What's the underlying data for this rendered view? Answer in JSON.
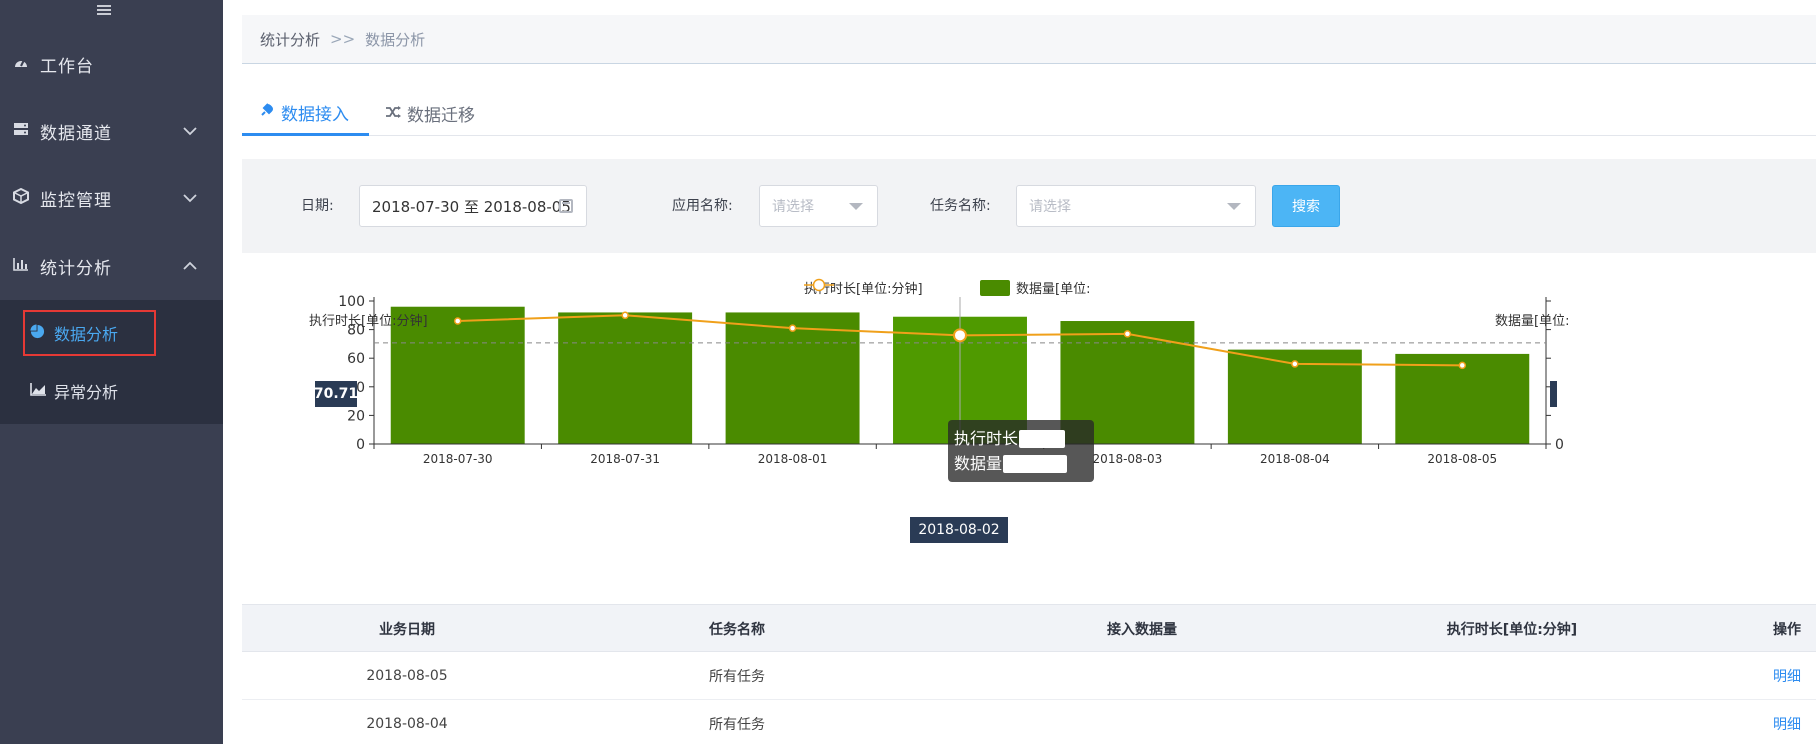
{
  "sidebar": {
    "items": [
      {
        "label": "工作台",
        "icon": "dashboard-icon",
        "chevron": ""
      },
      {
        "label": "数据通道",
        "icon": "server-icon",
        "chevron": "down"
      },
      {
        "label": "监控管理",
        "icon": "cube-icon",
        "chevron": "down"
      },
      {
        "label": "统计分析",
        "icon": "bar-chart-icon",
        "chevron": "up"
      }
    ],
    "sub_items": [
      {
        "label": "数据分析",
        "icon": "pie-chart-icon",
        "active": true
      },
      {
        "label": "异常分析",
        "icon": "area-chart-icon",
        "active": false
      }
    ]
  },
  "breadcrumb": {
    "parent": "统计分析",
    "separator": ">>",
    "current": "数据分析"
  },
  "tabs": [
    {
      "label": "数据接入",
      "icon": "plug-icon",
      "active": true
    },
    {
      "label": "数据迁移",
      "icon": "shuffle-icon",
      "active": false
    }
  ],
  "filter": {
    "date_label": "日期:",
    "date_value": "2018-07-30 至 2018-08-05",
    "app_label": "应用名称:",
    "app_placeholder": "请选择",
    "task_label": "任务名称:",
    "task_placeholder": "请选择",
    "search_label": "搜索"
  },
  "chart_data": {
    "type": "bar",
    "legend": [
      "执行时长[单位:分钟]",
      "数据量[单位:"
    ],
    "ylabel_left": "执行时长[单位:分钟]",
    "ylabel_right": "数据量[单位:",
    "categories": [
      "2018-07-30",
      "2018-07-31",
      "2018-08-01",
      "2018-08-02",
      "2018-08-03",
      "2018-08-04",
      "2018-08-05"
    ],
    "series": [
      {
        "name": "数据量[单位:",
        "type": "bar",
        "axis": "right",
        "values": [
          96,
          92,
          92,
          89,
          86,
          66,
          63
        ],
        "color": "#4a8b00"
      },
      {
        "name": "执行时长[单位:分钟]",
        "type": "line",
        "axis": "left",
        "values": [
          86,
          90,
          81,
          76,
          77,
          56,
          55
        ],
        "color": "#f0a01a"
      }
    ],
    "ylim": [
      0,
      100
    ],
    "yticks": [
      0,
      20,
      40,
      60,
      80,
      100
    ],
    "y2_ticks": [
      "0"
    ],
    "pointer_value": "70.71",
    "pointer_category": "2018-08-02",
    "tooltip": {
      "line1": "执行时长:",
      "line2": "数据量:"
    },
    "grid": false,
    "legend_position": "top-center"
  },
  "table": {
    "columns": [
      "业务日期",
      "任务名称",
      "接入数据量",
      "执行时长[单位:分钟]",
      "操作"
    ],
    "rows": [
      [
        "2018-08-05",
        "所有任务",
        "",
        "",
        "明细"
      ],
      [
        "2018-08-04",
        "所有任务",
        "",
        "",
        "明细"
      ]
    ]
  },
  "colors": {
    "sidebar": "#3a3f51",
    "accent": "#2d8cf0",
    "bar": "#4a8b00",
    "line": "#f0a01a",
    "pointer": "#2a3b55"
  }
}
